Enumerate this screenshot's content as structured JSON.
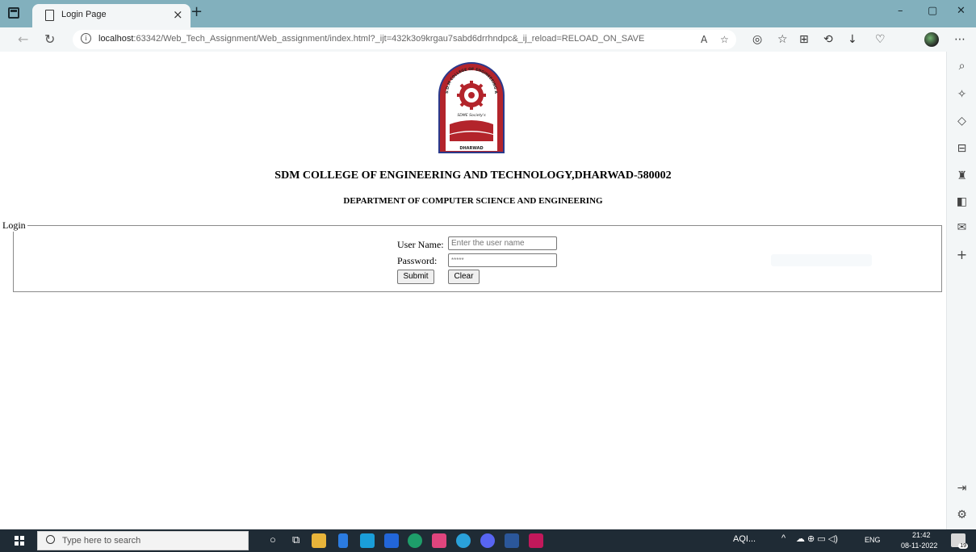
{
  "browser": {
    "tab_title": "Login Page",
    "tab_close": "×",
    "new_tab": "+",
    "url_host": "localhost",
    "url_rest": ":63342/Web_Tech_Assignment/Web_assignment/index.html?_ijt=432k3o9krgau7sabd6drrhndpc&_ij_reload=RELOAD_ON_SAVE",
    "window_controls": [
      "–",
      "▢",
      "✕"
    ]
  },
  "page": {
    "logo_text_top": "S.D.M COLLEGE OF ENGINEERING AND TECHNOLOGY",
    "logo_text_ribbon": "SDME Society's",
    "logo_text_bottom": "DHARWAD",
    "college_title": "SDM COLLEGE OF ENGINEERING AND TECHNOLOGY,DHARWAD-580002",
    "department_title": "DEPARTMENT OF COMPUTER SCIENCE AND ENGINEERING",
    "login": {
      "legend": "Login",
      "username_label": "User Name:",
      "username_placeholder": "Enter the user name",
      "password_label": "Password:",
      "password_value": "*****",
      "submit_label": "Submit",
      "clear_label": "Clear"
    }
  },
  "taskbar": {
    "search_placeholder": "Type here to search",
    "weather": "AQI...",
    "language": "ENG",
    "time": "21:42",
    "date": "08-11-2022",
    "notification_count": "19"
  },
  "colors": {
    "titlebar": "#82b0bd",
    "taskbar": "#1f2b35",
    "logo_red": "#b3242b",
    "logo_blue": "#2a3a8c"
  }
}
